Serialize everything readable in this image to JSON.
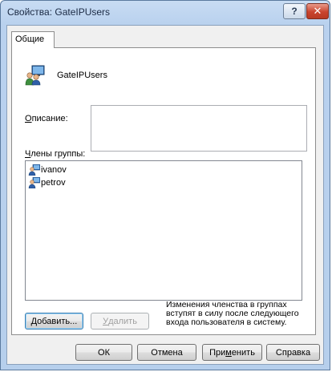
{
  "window": {
    "title": "Свойства: GateIPUsers"
  },
  "tabs": [
    {
      "label": "Общие"
    }
  ],
  "group": {
    "name": "GateIPUsers"
  },
  "description": {
    "label_pre": "",
    "label_mnemonic": "О",
    "label_post": "писание:",
    "value": ""
  },
  "members": {
    "label_mnemonic": "Ч",
    "label_post": "лены группы:",
    "items": [
      {
        "name": "ivanov"
      },
      {
        "name": "petrov"
      }
    ]
  },
  "buttons": {
    "add": {
      "mnemonic": "Д",
      "rest": "обавить..."
    },
    "remove": {
      "mnemonic": "У",
      "rest": "далить"
    },
    "ok": "ОК",
    "cancel": "Отмена",
    "apply": {
      "pre": "При",
      "mnemonic": "м",
      "post": "енить"
    },
    "help": "Справка"
  },
  "note": "Изменения членства в группах вступят в силу после следующего входа пользователя в систему.",
  "icons": {
    "help": "?",
    "close": "✕"
  }
}
